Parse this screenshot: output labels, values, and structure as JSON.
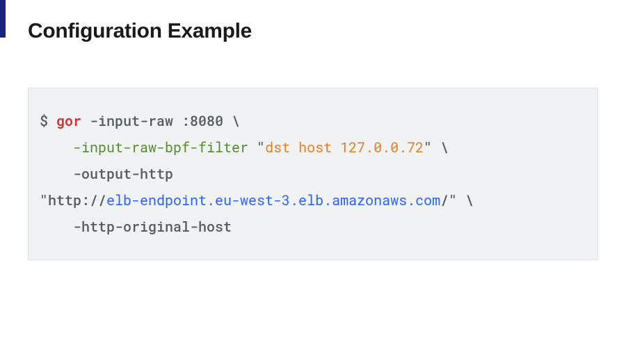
{
  "slide": {
    "title": "Configuration Example"
  },
  "code": {
    "l1_prompt": "$ ",
    "l1_cmd": "gor",
    "l1_rest": " -input-raw :8080 \\",
    "l2_indent": "    ",
    "l2_flag": "-input-raw-bpf-filter",
    "l2_space_q": " \"",
    "l2_val": "dst host 127.0.0.72",
    "l2_q_end": "\" \\",
    "l3_indent": "    ",
    "l3_flag": "-output-http",
    "l4_prefix": "\"http://",
    "l4_host": "elb-endpoint.eu-west-3.elb.amazonaws.com",
    "l4_suffix": "/\" \\",
    "l5_indent": "    ",
    "l5_flag": "-http-original-host"
  }
}
